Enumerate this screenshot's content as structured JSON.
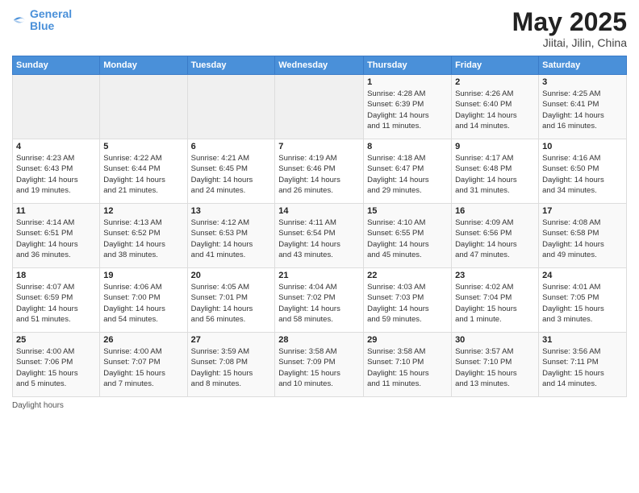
{
  "logo": {
    "line1": "General",
    "line2": "Blue"
  },
  "title": "May 2025",
  "location": "Jiitai, Jilin, China",
  "days_of_week": [
    "Sunday",
    "Monday",
    "Tuesday",
    "Wednesday",
    "Thursday",
    "Friday",
    "Saturday"
  ],
  "weeks": [
    [
      {
        "day": "",
        "info": ""
      },
      {
        "day": "",
        "info": ""
      },
      {
        "day": "",
        "info": ""
      },
      {
        "day": "",
        "info": ""
      },
      {
        "day": "1",
        "info": "Sunrise: 4:28 AM\nSunset: 6:39 PM\nDaylight: 14 hours\nand 11 minutes."
      },
      {
        "day": "2",
        "info": "Sunrise: 4:26 AM\nSunset: 6:40 PM\nDaylight: 14 hours\nand 14 minutes."
      },
      {
        "day": "3",
        "info": "Sunrise: 4:25 AM\nSunset: 6:41 PM\nDaylight: 14 hours\nand 16 minutes."
      }
    ],
    [
      {
        "day": "4",
        "info": "Sunrise: 4:23 AM\nSunset: 6:43 PM\nDaylight: 14 hours\nand 19 minutes."
      },
      {
        "day": "5",
        "info": "Sunrise: 4:22 AM\nSunset: 6:44 PM\nDaylight: 14 hours\nand 21 minutes."
      },
      {
        "day": "6",
        "info": "Sunrise: 4:21 AM\nSunset: 6:45 PM\nDaylight: 14 hours\nand 24 minutes."
      },
      {
        "day": "7",
        "info": "Sunrise: 4:19 AM\nSunset: 6:46 PM\nDaylight: 14 hours\nand 26 minutes."
      },
      {
        "day": "8",
        "info": "Sunrise: 4:18 AM\nSunset: 6:47 PM\nDaylight: 14 hours\nand 29 minutes."
      },
      {
        "day": "9",
        "info": "Sunrise: 4:17 AM\nSunset: 6:48 PM\nDaylight: 14 hours\nand 31 minutes."
      },
      {
        "day": "10",
        "info": "Sunrise: 4:16 AM\nSunset: 6:50 PM\nDaylight: 14 hours\nand 34 minutes."
      }
    ],
    [
      {
        "day": "11",
        "info": "Sunrise: 4:14 AM\nSunset: 6:51 PM\nDaylight: 14 hours\nand 36 minutes."
      },
      {
        "day": "12",
        "info": "Sunrise: 4:13 AM\nSunset: 6:52 PM\nDaylight: 14 hours\nand 38 minutes."
      },
      {
        "day": "13",
        "info": "Sunrise: 4:12 AM\nSunset: 6:53 PM\nDaylight: 14 hours\nand 41 minutes."
      },
      {
        "day": "14",
        "info": "Sunrise: 4:11 AM\nSunset: 6:54 PM\nDaylight: 14 hours\nand 43 minutes."
      },
      {
        "day": "15",
        "info": "Sunrise: 4:10 AM\nSunset: 6:55 PM\nDaylight: 14 hours\nand 45 minutes."
      },
      {
        "day": "16",
        "info": "Sunrise: 4:09 AM\nSunset: 6:56 PM\nDaylight: 14 hours\nand 47 minutes."
      },
      {
        "day": "17",
        "info": "Sunrise: 4:08 AM\nSunset: 6:58 PM\nDaylight: 14 hours\nand 49 minutes."
      }
    ],
    [
      {
        "day": "18",
        "info": "Sunrise: 4:07 AM\nSunset: 6:59 PM\nDaylight: 14 hours\nand 51 minutes."
      },
      {
        "day": "19",
        "info": "Sunrise: 4:06 AM\nSunset: 7:00 PM\nDaylight: 14 hours\nand 54 minutes."
      },
      {
        "day": "20",
        "info": "Sunrise: 4:05 AM\nSunset: 7:01 PM\nDaylight: 14 hours\nand 56 minutes."
      },
      {
        "day": "21",
        "info": "Sunrise: 4:04 AM\nSunset: 7:02 PM\nDaylight: 14 hours\nand 58 minutes."
      },
      {
        "day": "22",
        "info": "Sunrise: 4:03 AM\nSunset: 7:03 PM\nDaylight: 14 hours\nand 59 minutes."
      },
      {
        "day": "23",
        "info": "Sunrise: 4:02 AM\nSunset: 7:04 PM\nDaylight: 15 hours\nand 1 minute."
      },
      {
        "day": "24",
        "info": "Sunrise: 4:01 AM\nSunset: 7:05 PM\nDaylight: 15 hours\nand 3 minutes."
      }
    ],
    [
      {
        "day": "25",
        "info": "Sunrise: 4:00 AM\nSunset: 7:06 PM\nDaylight: 15 hours\nand 5 minutes."
      },
      {
        "day": "26",
        "info": "Sunrise: 4:00 AM\nSunset: 7:07 PM\nDaylight: 15 hours\nand 7 minutes."
      },
      {
        "day": "27",
        "info": "Sunrise: 3:59 AM\nSunset: 7:08 PM\nDaylight: 15 hours\nand 8 minutes."
      },
      {
        "day": "28",
        "info": "Sunrise: 3:58 AM\nSunset: 7:09 PM\nDaylight: 15 hours\nand 10 minutes."
      },
      {
        "day": "29",
        "info": "Sunrise: 3:58 AM\nSunset: 7:10 PM\nDaylight: 15 hours\nand 11 minutes."
      },
      {
        "day": "30",
        "info": "Sunrise: 3:57 AM\nSunset: 7:10 PM\nDaylight: 15 hours\nand 13 minutes."
      },
      {
        "day": "31",
        "info": "Sunrise: 3:56 AM\nSunset: 7:11 PM\nDaylight: 15 hours\nand 14 minutes."
      }
    ]
  ],
  "footer": "Daylight hours"
}
